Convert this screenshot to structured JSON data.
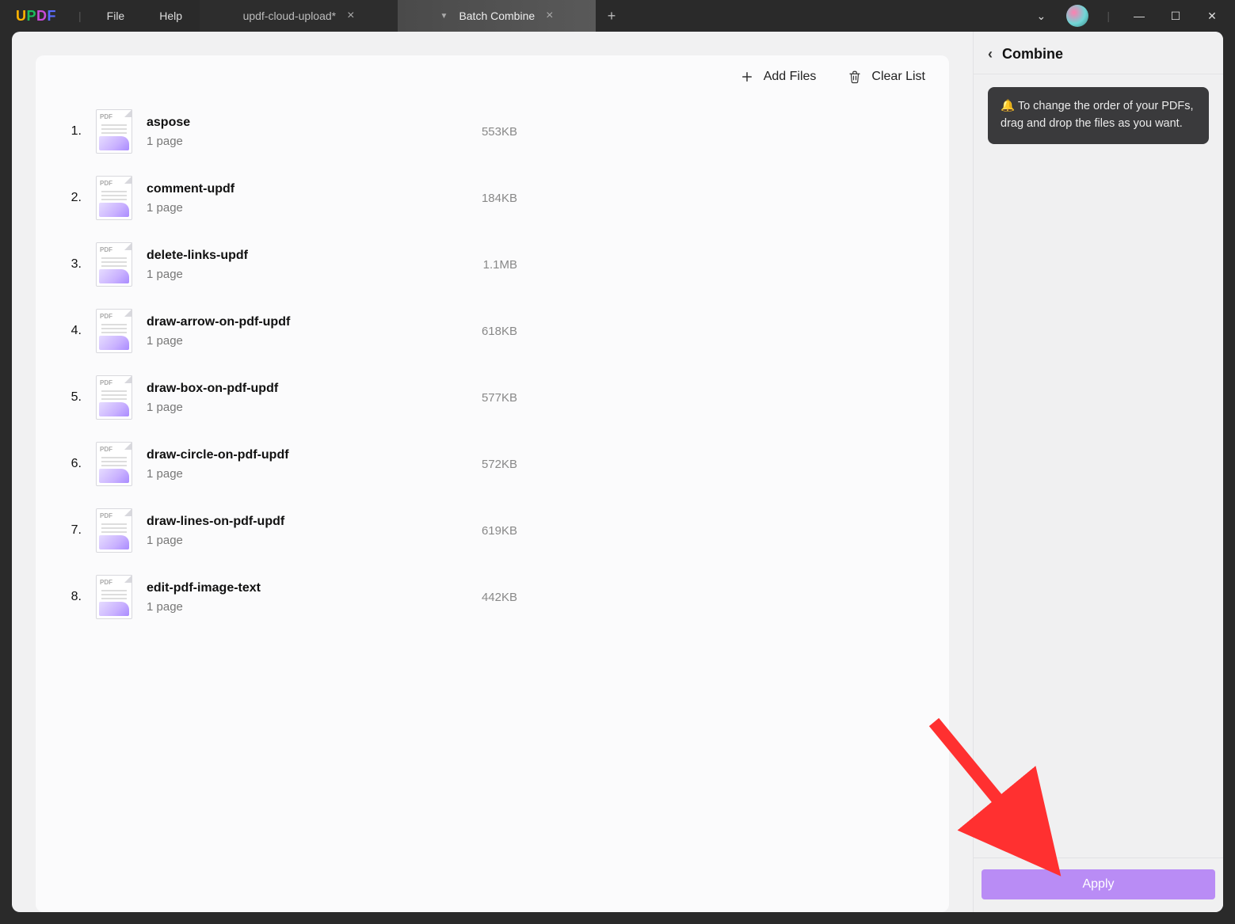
{
  "app": {
    "name": "UPDF"
  },
  "menu": {
    "file": "File",
    "help": "Help"
  },
  "tabs": [
    {
      "label": "updf-cloud-upload*",
      "active": false
    },
    {
      "label": "Batch Combine",
      "active": true
    }
  ],
  "toolbar": {
    "add_files": "Add Files",
    "clear_list": "Clear List"
  },
  "files": [
    {
      "num": "1.",
      "name": "aspose",
      "pages": "1 page",
      "size": "553KB"
    },
    {
      "num": "2.",
      "name": "comment-updf",
      "pages": "1 page",
      "size": "184KB"
    },
    {
      "num": "3.",
      "name": "delete-links-updf",
      "pages": "1 page",
      "size": "1.1MB"
    },
    {
      "num": "4.",
      "name": "draw-arrow-on-pdf-updf",
      "pages": "1 page",
      "size": "618KB"
    },
    {
      "num": "5.",
      "name": "draw-box-on-pdf-updf",
      "pages": "1 page",
      "size": "577KB"
    },
    {
      "num": "6.",
      "name": "draw-circle-on-pdf-updf",
      "pages": "1 page",
      "size": "572KB"
    },
    {
      "num": "7.",
      "name": "draw-lines-on-pdf-updf",
      "pages": "1 page",
      "size": "619KB"
    },
    {
      "num": "8.",
      "name": "edit-pdf-image-text",
      "pages": "1 page",
      "size": "442KB"
    }
  ],
  "sidebar": {
    "title": "Combine",
    "tip_icon": "🔔",
    "tip_text": "To change the order of your PDFs, drag and drop the files as you want.",
    "apply": "Apply"
  },
  "thumb_label": "PDF"
}
